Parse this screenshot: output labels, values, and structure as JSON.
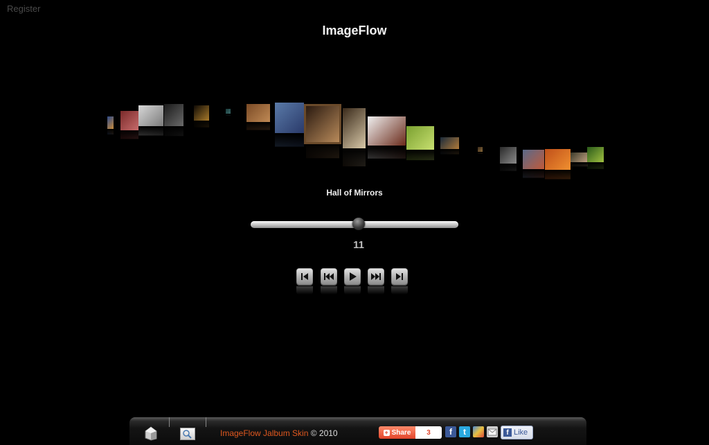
{
  "header": {
    "register_link": "Register",
    "title": "ImageFlow"
  },
  "gallery": {
    "current_caption": "Hall of Mirrors",
    "current_index": "11",
    "slider_position": 0.52,
    "thumbnails": [
      {
        "colors": [
          "#2d4a8a",
          "#c88a3a"
        ]
      },
      {
        "colors": [
          "#7a2a2a",
          "#c76b6b"
        ]
      },
      {
        "colors": [
          "#d8d8d8",
          "#7b7b7b"
        ]
      },
      {
        "colors": [
          "#1a1a1a",
          "#6a6a6a"
        ]
      },
      {
        "colors": [
          "#0f0a05",
          "#a87a2a"
        ]
      },
      {
        "colors": [
          "#1a3a3a",
          "#3a6a6a"
        ]
      },
      {
        "colors": [
          "#7a4a25",
          "#c08a55"
        ]
      },
      {
        "colors": [
          "#5a7aa8",
          "#2a3a6a"
        ]
      },
      {
        "colors": [
          "#2a1a10",
          "#b88a5a"
        ]
      },
      {
        "colors": [
          "#3a2a1a",
          "#d8c8a8"
        ]
      },
      {
        "colors": [
          "#f0f0f0",
          "#6a2a1a"
        ]
      },
      {
        "colors": [
          "#7aa030",
          "#c8e070"
        ]
      },
      {
        "colors": [
          "#1a2a3a",
          "#b07a3a"
        ]
      },
      {
        "colors": [
          "#3a2a1a",
          "#8a6a3a"
        ]
      },
      {
        "colors": [
          "#2a2a2a",
          "#8a8a8a"
        ]
      },
      {
        "colors": [
          "#5a6a8a",
          "#c05a3a"
        ]
      },
      {
        "colors": [
          "#c0501a",
          "#f09030"
        ]
      },
      {
        "colors": [
          "#3a3a2a",
          "#c0a080"
        ]
      },
      {
        "colors": [
          "#2a5a1a",
          "#a0c040"
        ]
      }
    ]
  },
  "controls": [
    {
      "name": "first-button",
      "icon": "skip-first-icon"
    },
    {
      "name": "previous-button",
      "icon": "rewind-icon"
    },
    {
      "name": "play-button",
      "icon": "play-icon"
    },
    {
      "name": "next-button",
      "icon": "fast-forward-icon"
    },
    {
      "name": "last-button",
      "icon": "skip-last-icon"
    }
  ],
  "footer": {
    "credit_link": "ImageFlow Jalbum Skin",
    "credit_rest": " © 2010",
    "share_label": "Share",
    "share_count": "3",
    "like_label": "Like",
    "colors": {
      "accent": "#e0581f",
      "facebook": "#3b5998",
      "twitter": "#2aa9e0"
    }
  }
}
